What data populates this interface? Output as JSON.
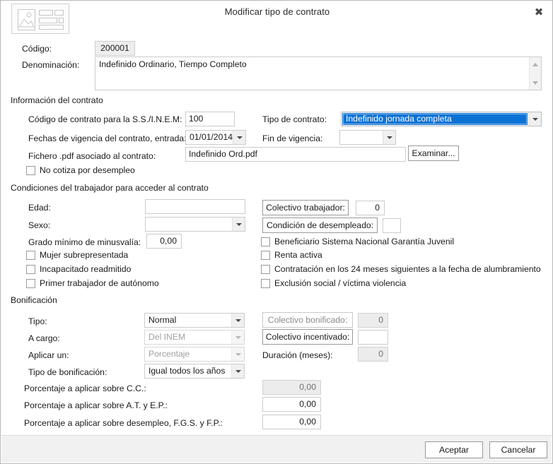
{
  "window": {
    "title": "Modificar tipo de contrato",
    "close_label": "✖",
    "app_icon": "form-layout-icon"
  },
  "header_fields": {
    "codigo_label": "Código:",
    "codigo_value": "200001",
    "denominacion_label": "Denominación:",
    "denominacion_value": "Indefinido Ordinario, Tiempo Completo"
  },
  "info_contrato": {
    "group_title": "Información del contrato",
    "codigo_ss_label": "Código de contrato para la S.S./I.N.E.M:",
    "codigo_ss_value": "100",
    "tipo_contrato_label": "Tipo de contrato:",
    "tipo_contrato_value": "Indefinido jornada completa",
    "fechas_label": "Fechas de vigencia del contrato, entrada:",
    "fechas_value": "01/01/2014",
    "fin_vigencia_label": "Fin de vigencia:",
    "fin_vigencia_value": "",
    "fichero_label": "Fichero .pdf asociado al contrato:",
    "fichero_value": "Indefinido Ord.pdf",
    "examinar_label": "Examinar...",
    "no_cotiza_label": "No cotiza por desempleo"
  },
  "condiciones": {
    "group_title": "Condiciones del trabajador para acceder al contrato",
    "edad_label": "Edad:",
    "edad_value": "",
    "sexo_label": "Sexo:",
    "sexo_value": "",
    "grado_label": "Grado mínimo de minusvalía:",
    "grado_value": "0,00",
    "mujer_label": "Mujer subrepresentada",
    "incapacitado_label": "Incapacitado readmitido",
    "primer_trabajador_label": "Primer trabajador de autónomo",
    "colectivo_trabajador_label": "Colectivo trabajador:",
    "colectivo_trabajador_value": "0",
    "condicion_desempleado_label": "Condición de desempleado:",
    "condicion_desempleado_value": "",
    "beneficiario_label": "Beneficiario Sistema Nacional Garantía Juvenil",
    "renta_activa_label": "Renta activa",
    "contratacion_24_label": "Contratación en los 24 meses siguientes a la fecha de alumbramiento",
    "exclusion_social_label": "Exclusión social  / víctima violencia"
  },
  "bonificacion": {
    "group_title": "Bonificación",
    "tipo_label": "Tipo:",
    "tipo_value": "Normal",
    "a_cargo_label": "A cargo:",
    "a_cargo_value": "Del INEM",
    "aplicar_label": "Aplicar un:",
    "aplicar_value": "Porcentaje",
    "tipo_bonif_label": "Tipo de bonificación:",
    "tipo_bonif_value": "Igual todos los años",
    "colectivo_bonificado_label": "Colectivo bonificado:",
    "colectivo_bonificado_value": "0",
    "colectivo_incentivado_label": "Colectivo incentivado:",
    "colectivo_incentivado_value": "",
    "duracion_label": "Duración (meses):",
    "duracion_value": "0",
    "pct_cc_label": "Porcentaje a aplicar sobre C.C.:",
    "pct_cc_value": "0,00",
    "pct_at_label": "Porcentaje a aplicar sobre A.T. y E.P.:",
    "pct_at_value": "0,00",
    "pct_desempleo_label": "Porcentaje a aplicar sobre desempleo, F.G.S. y F.P.:",
    "pct_desempleo_value": "0,00"
  },
  "footer": {
    "aceptar_label": "Aceptar",
    "cancelar_label": "Cancelar"
  },
  "colors": {
    "selection_blue": "#0b72d4",
    "window_bg": "#ffffff",
    "footer_bg": "#f1f1f1",
    "field_border": "#cccccc",
    "disabled_bg": "#ececec"
  }
}
